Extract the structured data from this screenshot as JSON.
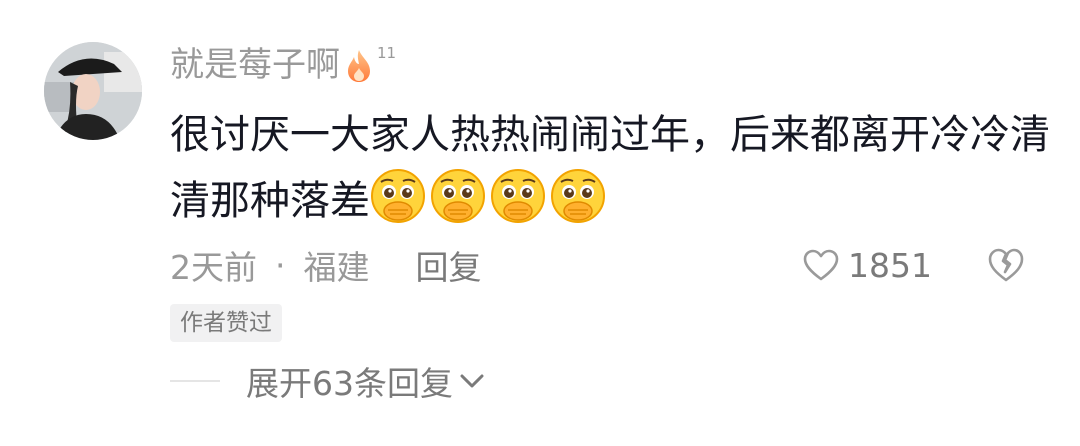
{
  "comment": {
    "username": "就是莓子啊",
    "level_badge": "11",
    "text": "很讨厌一大家人热热闹闹过年，后来都离开冷冷清清那种落差",
    "emojis": [
      "pleading-face-icon",
      "pleading-face-icon",
      "pleading-face-icon",
      "pleading-face-icon"
    ],
    "time": "2天前",
    "separator": "·",
    "location": "福建",
    "reply_label": "回复",
    "like_count": "1851",
    "author_badge": "作者赞过",
    "expand_label": "展开63条回复"
  },
  "icons": {
    "fire": "fire-icon",
    "heart": "heart-outline-icon",
    "broken_heart": "broken-heart-icon",
    "chevron": "chevron-down-icon"
  },
  "colors": {
    "text_primary": "#161823",
    "text_secondary": "#999999",
    "fire_gradient": "#ff8a3d",
    "badge_bg": "#f1f1f2"
  }
}
